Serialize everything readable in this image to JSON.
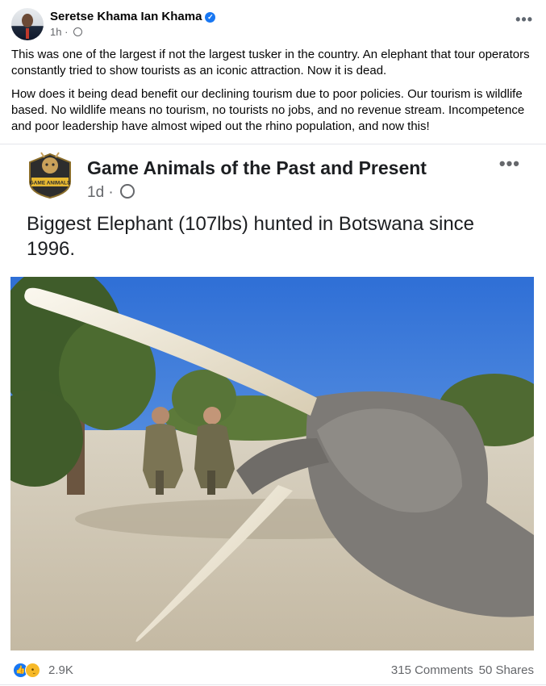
{
  "post": {
    "author": "Seretse Khama Ian Khama",
    "time": "1h",
    "paragraphs": [
      "This was one of the largest if not the largest tusker in the country. An elephant that tour operators constantly tried to show tourists as an iconic attraction. Now it is dead.",
      "How does it being dead benefit our declining tourism due to poor policies. Our tourism is wildlife based. No wildlife means no tourism, no tourists no jobs, and no revenue stream. Incompetence and poor leadership have almost wiped out the rhino population, and now this!"
    ]
  },
  "shared": {
    "page_name": "Game Animals of the Past and Present",
    "logo_text": "GAME ANIMALS",
    "time": "1d",
    "text": "Biggest Elephant (107lbs) hunted in Botswana since 1996."
  },
  "footer": {
    "reaction_count": "2.9K",
    "comments": "315 Comments",
    "shares": "50 Shares"
  },
  "icons": {
    "verified": "verified-badge-icon",
    "privacy": "globe-icon",
    "more": "more-options-icon",
    "reactions": [
      "like-reaction-icon",
      "sad-reaction-icon"
    ]
  },
  "colors": {
    "accent": "#1877f2",
    "meta_text": "#65676b"
  }
}
